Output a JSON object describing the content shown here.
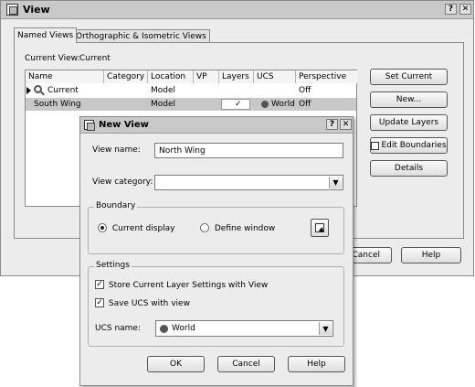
{
  "view_dialog": {
    "title": "View",
    "title_buttons": {
      "help": "?",
      "close": "✕"
    },
    "tabs": [
      {
        "label": "Named Views"
      },
      {
        "label": "Orthographic & Isometric Views"
      }
    ],
    "current_view_label": "Current View:",
    "current_view_value": "Current",
    "table": {
      "columns": [
        "Name",
        "Category",
        "Location",
        "VP",
        "Layers",
        "UCS",
        "Perspective"
      ],
      "rows": [
        {
          "name": "Current",
          "category": "",
          "location": "Model",
          "vp": "",
          "layers": "",
          "ucs": "",
          "perspective": "Off"
        },
        {
          "name": "South Wing",
          "category": "",
          "location": "Model",
          "vp": "",
          "layers": "✓",
          "ucs": "World",
          "perspective": "Off"
        }
      ]
    },
    "buttons": {
      "set_current": "Set Current",
      "new": "New...",
      "update_layers": "Update Layers",
      "edit_boundaries": "Edit Boundaries",
      "details": "Details",
      "cancel": "Cancel",
      "help": "Help"
    }
  },
  "new_view_dialog": {
    "title": "New View",
    "title_buttons": {
      "help": "?",
      "close": "✕"
    },
    "view_name_label": "View name:",
    "view_name_value": "North Wing",
    "view_category_label": "View category:",
    "view_category_value": "",
    "boundary": {
      "title": "Boundary",
      "current_display": "Current display",
      "define_window": "Define window",
      "selected": "current_display"
    },
    "settings": {
      "title": "Settings",
      "store_layers": "Store Current Layer Settings with View",
      "store_layers_checked": true,
      "save_ucs": "Save UCS with view",
      "save_ucs_checked": true,
      "ucs_name_label": "UCS name:",
      "ucs_name_value": "World"
    },
    "buttons": {
      "ok": "OK",
      "cancel": "Cancel",
      "help": "Help"
    }
  },
  "colors": {
    "dialog_bg": "#ececec",
    "titlebar": "#c9c9c9",
    "selection": "#d0d0d0"
  }
}
